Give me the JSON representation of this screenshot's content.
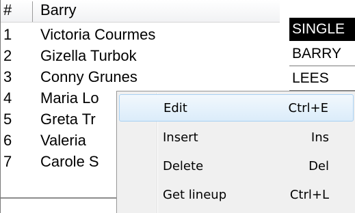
{
  "list": {
    "columns": [
      "#",
      "Barry"
    ],
    "rows": [
      {
        "num": "1",
        "name": "Victoria Courmes"
      },
      {
        "num": "2",
        "name": "Gizella Turbok"
      },
      {
        "num": "3",
        "name": "Conny Grunes"
      },
      {
        "num": "4",
        "name": "Maria Lo"
      },
      {
        "num": "5",
        "name": "Greta Tr"
      },
      {
        "num": "6",
        "name": "Valeria"
      },
      {
        "num": "7",
        "name": "Carole S"
      }
    ]
  },
  "right_column": {
    "items": [
      "SINGLE",
      "BARRY",
      "LEES"
    ],
    "selected_index": 0
  },
  "context_menu": {
    "items": [
      {
        "label": "Edit",
        "shortcut": "Ctrl+E"
      },
      {
        "label": "Insert",
        "shortcut": "Ins"
      },
      {
        "label": "Delete",
        "shortcut": "Del"
      },
      {
        "label": "Get lineup",
        "shortcut": "Ctrl+L"
      }
    ],
    "highlighted_index": 0
  },
  "colors": {
    "highlight_fill": "#dbecfa",
    "highlight_border": "#a8d1f3",
    "menu_background": "#f0f0f0",
    "selected_background": "#000000",
    "selected_text": "#ffffff"
  }
}
